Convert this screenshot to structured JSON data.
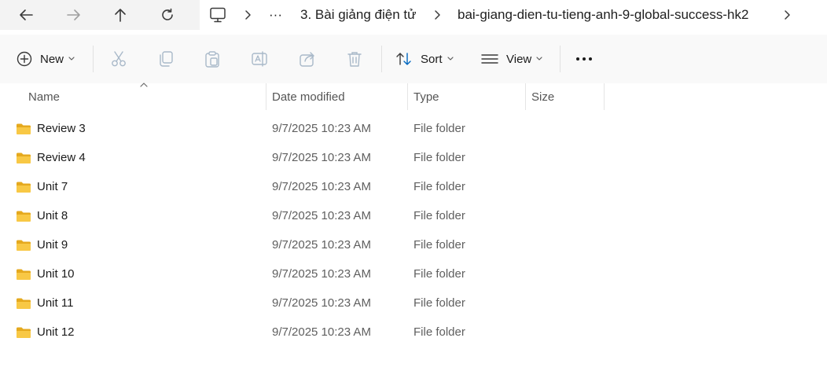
{
  "nav": {
    "back_icon": "arrow-left-icon",
    "forward_icon": "arrow-right-icon",
    "up_icon": "arrow-up-icon",
    "refresh_icon": "refresh-icon"
  },
  "breadcrumb": {
    "root_icon": "this-pc-icon",
    "overflow": "···",
    "items": [
      "3. Bài giảng điện tử",
      "bai-giang-dien-tu-tieng-anh-9-global-success-hk2"
    ]
  },
  "toolbar": {
    "new_label": "New",
    "sort_label": "Sort",
    "view_label": "View",
    "more_label": "•••"
  },
  "columns": {
    "name": "Name",
    "date_modified": "Date modified",
    "type": "Type",
    "size": "Size"
  },
  "files": [
    {
      "name": "Review 3",
      "date": "9/7/2025 10:23 AM",
      "type": "File folder",
      "size": ""
    },
    {
      "name": "Review 4",
      "date": "9/7/2025 10:23 AM",
      "type": "File folder",
      "size": ""
    },
    {
      "name": "Unit 7",
      "date": "9/7/2025 10:23 AM",
      "type": "File folder",
      "size": ""
    },
    {
      "name": "Unit 8",
      "date": "9/7/2025 10:23 AM",
      "type": "File folder",
      "size": ""
    },
    {
      "name": "Unit 9",
      "date": "9/7/2025 10:23 AM",
      "type": "File folder",
      "size": ""
    },
    {
      "name": "Unit 10",
      "date": "9/7/2025 10:23 AM",
      "type": "File folder",
      "size": ""
    },
    {
      "name": "Unit 11",
      "date": "9/7/2025 10:23 AM",
      "type": "File folder",
      "size": ""
    },
    {
      "name": "Unit 12",
      "date": "9/7/2025 10:23 AM",
      "type": "File folder",
      "size": ""
    }
  ],
  "colors": {
    "folder": "#f5c342",
    "folder_dark": "#e5a91e",
    "accent": "#0067c0",
    "disabled_icon": "#a9b9c9"
  }
}
